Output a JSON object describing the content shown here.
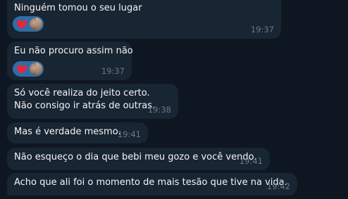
{
  "messages": [
    {
      "text": "Ninguém tomou o seu lugar",
      "time": "19:37",
      "reaction": "heart"
    },
    {
      "text": "Eu não procuro assim não",
      "time": "19:37",
      "reaction": "heart"
    },
    {
      "line1": "Só você realiza do jeito certo.",
      "line2": "Não consigo ir atrás de outras.",
      "time": "19:38"
    },
    {
      "text": "Mas é verdade mesmo.",
      "time": "19:41"
    },
    {
      "text": "Não esqueço o dia que bebi meu gozo e você vendo.",
      "time": "19:41"
    },
    {
      "text": "Acho que ali foi o momento de mais tesão que tive na vida.",
      "time": "19:42"
    }
  ],
  "colors": {
    "background": "#0e1621",
    "bubble": "#182533",
    "reaction": "#2f6ea5",
    "time": "#6c7883"
  }
}
